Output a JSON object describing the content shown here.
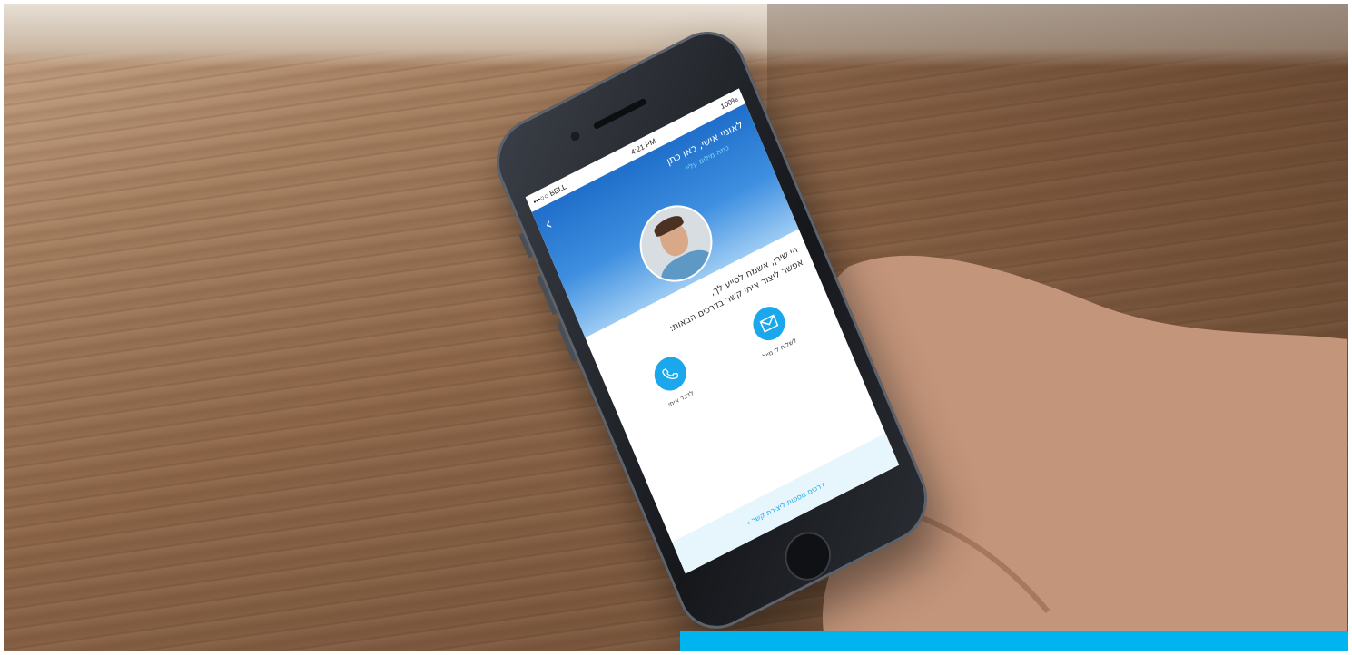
{
  "phone": {
    "status_carrier": "•••○○ BELL",
    "status_time": "4:21 PM",
    "status_battery": "100%",
    "back_glyph": "‹",
    "title": "לאומי אישי, כאן כתן",
    "subtitle": "כמה מילים עליי",
    "greeting_line1": "הי שירן, אשמח לסייע לך,",
    "greeting_line2": "אפשר ליצור איתי קשר בדרכים הבאות:",
    "actions": [
      {
        "icon": "envelope-icon",
        "label": "לשלוח לי מייל"
      },
      {
        "icon": "phone-icon",
        "label": "לדבר איתי"
      }
    ],
    "more_link": "דרכים נוספות ליצירת קשר ›"
  },
  "colors": {
    "accent": "#1aa7ec",
    "hero_top": "#1f6fcb",
    "banner": "#00b4f0"
  }
}
